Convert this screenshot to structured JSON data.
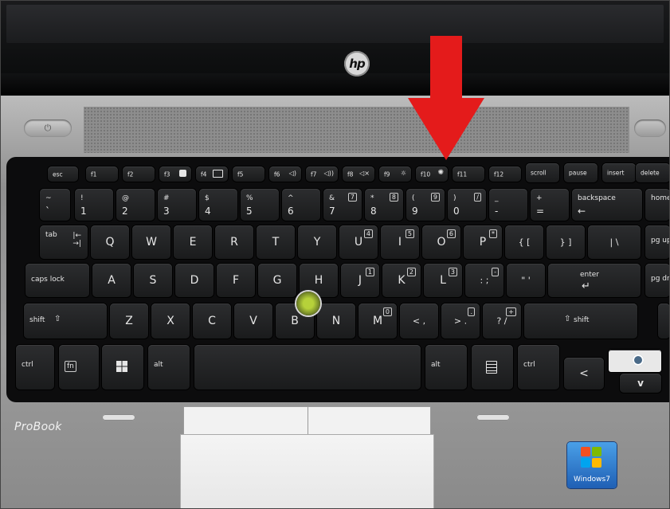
{
  "photo": {
    "laptop_brand_logo": "hp",
    "model_label": "ProBook",
    "os_badge": "Windows7",
    "power_button_icon": "power-icon"
  },
  "annotation": {
    "arrow_color": "#e41b1b",
    "arrow_direction": "down"
  },
  "keyboard": {
    "function_row": [
      {
        "id": "esc",
        "label": "esc"
      },
      {
        "id": "f1",
        "label": "f1"
      },
      {
        "id": "f2",
        "label": "f2"
      },
      {
        "id": "f3",
        "label": "f3"
      },
      {
        "id": "f4",
        "label": "f4"
      },
      {
        "id": "f5",
        "label": "f5"
      },
      {
        "id": "f6",
        "label": "f6"
      },
      {
        "id": "f7",
        "label": "f7"
      },
      {
        "id": "f8",
        "label": "f8"
      },
      {
        "id": "f9",
        "label": "f9"
      },
      {
        "id": "f10",
        "label": "f10"
      },
      {
        "id": "f11",
        "label": "f11"
      },
      {
        "id": "f12",
        "label": "f12"
      },
      {
        "id": "scroll",
        "label": "scroll"
      },
      {
        "id": "pause",
        "label": "pause"
      },
      {
        "id": "insert",
        "label": "insert"
      },
      {
        "id": "delete",
        "label": "delete"
      }
    ],
    "number_row": [
      {
        "top": "~",
        "bottom": "`"
      },
      {
        "top": "!",
        "bottom": "1"
      },
      {
        "top": "@",
        "bottom": "2"
      },
      {
        "top": "#",
        "bottom": "3"
      },
      {
        "top": "$",
        "bottom": "4"
      },
      {
        "top": "%",
        "bottom": "5"
      },
      {
        "top": "^",
        "bottom": "6"
      },
      {
        "top": "&",
        "bottom": "7",
        "numpad": "7"
      },
      {
        "top": "*",
        "bottom": "8",
        "numpad": "8"
      },
      {
        "top": "(",
        "bottom": "9",
        "numpad": "9"
      },
      {
        "top": ")",
        "bottom": "0",
        "numpad": "/"
      },
      {
        "top": "_",
        "bottom": "-"
      },
      {
        "top": "+",
        "bottom": "="
      },
      {
        "top": "backspace",
        "bottom": "←"
      },
      {
        "top": "home",
        "bottom": ""
      }
    ],
    "qwerty_row": [
      {
        "label": "tab"
      },
      {
        "label": "Q"
      },
      {
        "label": "W"
      },
      {
        "label": "E"
      },
      {
        "label": "R"
      },
      {
        "label": "T"
      },
      {
        "label": "Y"
      },
      {
        "label": "U",
        "numpad": "4"
      },
      {
        "label": "I",
        "numpad": "5"
      },
      {
        "label": "O",
        "numpad": "6"
      },
      {
        "label": "P",
        "numpad": "*"
      },
      {
        "label": "{ ["
      },
      {
        "label": "} ]"
      },
      {
        "label": "| \\"
      },
      {
        "label": "pg up"
      }
    ],
    "home_row": [
      {
        "label": "caps lock"
      },
      {
        "label": "A"
      },
      {
        "label": "S"
      },
      {
        "label": "D"
      },
      {
        "label": "F"
      },
      {
        "label": "G"
      },
      {
        "label": "H"
      },
      {
        "label": "J",
        "numpad": "1"
      },
      {
        "label": "K",
        "numpad": "2"
      },
      {
        "label": "L",
        "numpad": "3"
      },
      {
        "label": ": ;",
        "numpad": "-"
      },
      {
        "label": "\" '"
      },
      {
        "label": "enter"
      },
      {
        "label": "pg dn"
      }
    ],
    "shift_row": [
      {
        "label": "shift"
      },
      {
        "label": "Z"
      },
      {
        "label": "X"
      },
      {
        "label": "C"
      },
      {
        "label": "V"
      },
      {
        "label": "B"
      },
      {
        "label": "N"
      },
      {
        "label": "M",
        "numpad": "0"
      },
      {
        "label": "< ,"
      },
      {
        "label": "> .",
        "numpad": "."
      },
      {
        "label": "? /",
        "numpad": "+"
      },
      {
        "label": "shift"
      }
    ],
    "bottom_row": [
      {
        "label": "ctrl"
      },
      {
        "label": "fn"
      },
      {
        "label": "win"
      },
      {
        "label": "alt"
      },
      {
        "label": ""
      },
      {
        "label": "alt"
      },
      {
        "label": "menu"
      },
      {
        "label": "ctrl"
      },
      {
        "label": "<"
      },
      {
        "label": "v"
      }
    ]
  }
}
